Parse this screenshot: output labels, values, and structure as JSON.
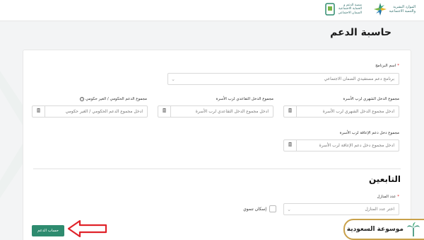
{
  "header": {
    "ministry_logo_text": [
      "الموارد البشرية",
      "والتنمية الاجتماعية"
    ],
    "fund_logo_text": [
      "منصة الدعم و",
      "الحماية الاجتماعية",
      "الضمان الاجتماعي"
    ]
  },
  "page": {
    "title": "حاسبة الدعم"
  },
  "form": {
    "program": {
      "label": "اسم البرنامج",
      "value": "برنامج دعم مستفيدي الضمان الاجتماعي"
    },
    "monthly_income": {
      "label": "مجموع الدخل الشهري لرب الأسرة",
      "placeholder": "ادخل مجموع الدخل الشهري لرب الأسرة"
    },
    "pension_income": {
      "label": "مجموع الدخل التقاعدي لرب الأسرة",
      "placeholder": "ادخل مجموع الدخل التقاعدي لرب الأسرة"
    },
    "gov_support": {
      "label": "مجموع الدعم الحكومي / الغير حكومي",
      "placeholder": "ادخل مجموع الدعم الحكومي / الغير حكومي"
    },
    "disability_income": {
      "label": "مجموع دخل دعم الإعاقة لرب الأسرة",
      "placeholder": "ادخل مجموع دخل دعم الإعاقة لرب الأسرة"
    }
  },
  "dependents": {
    "title": "التابعين",
    "count_label": "عدد المنازل",
    "count_placeholder": "اختر عدد المنازل",
    "housing_checkbox_label": "إسكان تنموي"
  },
  "actions": {
    "calculate_label": "حساب الدعم"
  },
  "brand": {
    "name": "موسوعة السعودية"
  },
  "colors": {
    "primary": "#2e8b6f",
    "arrow": "#e0232a",
    "brand_border": "#c9a14b"
  }
}
